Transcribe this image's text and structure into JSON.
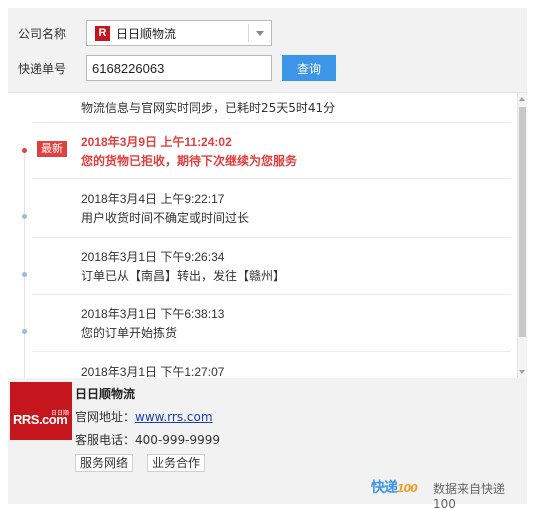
{
  "form": {
    "company_label": "公司名称",
    "company_logo_letter": "R",
    "company_value": "日日顺物流",
    "tracking_label": "快递单号",
    "tracking_value": "6168226063",
    "query_button": "查询"
  },
  "timeline": {
    "sync_text": "物流信息与官网实时同步，已耗时25天5时41分",
    "latest_badge": "最新",
    "events": [
      {
        "timestamp": "2018年3月9日 上午11:24:02",
        "description": "您的货物已拒收，期待下次继续为您服务"
      },
      {
        "timestamp": "2018年3月4日 上午9:22:17",
        "description": "用户收货时间不确定或时间过长"
      },
      {
        "timestamp": "2018年3月1日 下午9:26:34",
        "description": "订单已从【南昌】转出，发往【赣州】"
      },
      {
        "timestamp": "2018年3月1日 下午6:38:13",
        "description": "您的订单开始拣货"
      },
      {
        "timestamp": "2018年3月1日 下午1:27:07",
        "description": ""
      }
    ]
  },
  "company_info": {
    "logo_text": "RRS.com",
    "logo_small": "日日顺",
    "name": "日日顺物流",
    "website_label": "官网地址：",
    "website_url": "www.rrs.com",
    "phone_label": "客服电话：",
    "phone": "400-999-9999",
    "buttons": [
      "服务网络",
      "业务合作"
    ]
  },
  "footer": {
    "logo_text": "快递",
    "logo_num": "100",
    "source_text": "数据来自快递100"
  },
  "colors": {
    "accent": "#3c95e6",
    "latest": "#e04040",
    "brand_red": "#c4161c"
  }
}
